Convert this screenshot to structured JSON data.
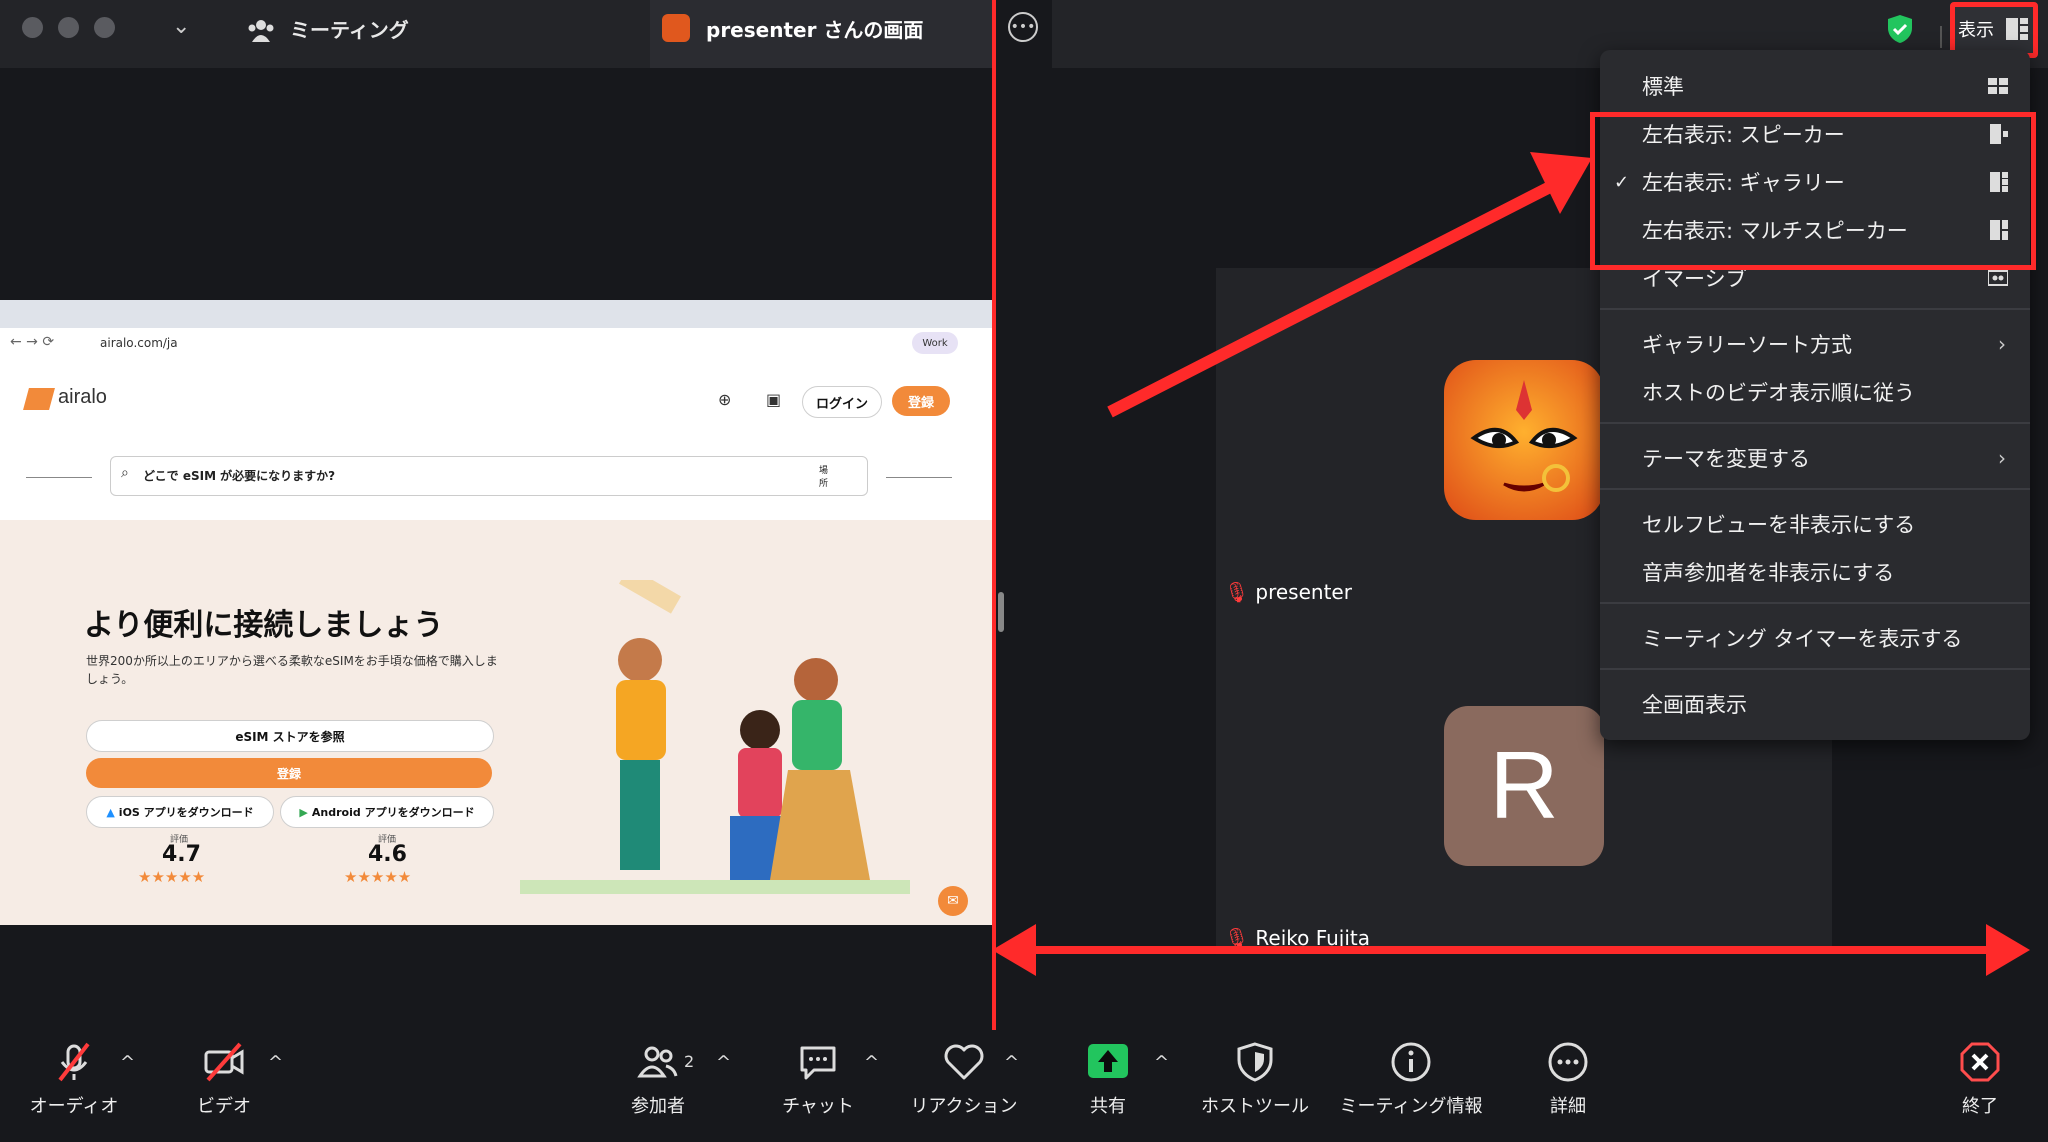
{
  "window": {
    "meeting_title": "ミーティング",
    "presenter_tab": "presenter さんの画面"
  },
  "header_right": {
    "view_label": "表示"
  },
  "view_menu": {
    "items": [
      {
        "label": "標準",
        "checked": false,
        "icon": "grid-icon"
      },
      {
        "label": "左右表示: スピーカー",
        "checked": false,
        "icon": "side-speaker-icon"
      },
      {
        "label": "左右表示: ギャラリー",
        "checked": true,
        "icon": "side-gallery-icon"
      },
      {
        "label": "左右表示: マルチスピーカー",
        "checked": false,
        "icon": "side-multi-icon"
      },
      {
        "label": "イマーシブ",
        "checked": false,
        "icon": "immersive-icon"
      },
      {
        "label": "ギャラリーソート方式",
        "submenu": true
      },
      {
        "label": "ホストのビデオ表示順に従う"
      },
      {
        "label": "テーマを変更する",
        "submenu": true
      },
      {
        "label": "セルフビューを非表示にする"
      },
      {
        "label": "音声参加者を非表示にする"
      },
      {
        "label": "ミーティング タイマーを表示する"
      },
      {
        "label": "全画面表示"
      }
    ],
    "checkmark": "✓",
    "chevron": "›"
  },
  "participants_view": {
    "presenter_name": "presenter",
    "reiko_name": "Reiko Fujita",
    "reiko_initial": "R"
  },
  "shared_screen": {
    "address": "airalo.com/ja",
    "work_badge": "Work",
    "logo": "airalo",
    "login": "ログイン",
    "register": "登録",
    "search_placeholder": "どこで eSIM が必要になりますか?",
    "search_scope": "場所",
    "hero_title": "より便利に接続しましょう",
    "hero_desc": "世界200か所以上のエリアから選べる柔軟なeSIMをお手頃な価格で購入しましょう。",
    "store_button": "eSIM ストアを参照",
    "signup_button": "登録",
    "ios_button": "iOS アプリをダウンロード",
    "android_button": "Android アプリをダウンロード",
    "rating_label": "評価",
    "ios_rating": "4.7",
    "android_rating": "4.6",
    "stars": "★★★★★"
  },
  "toolbar": {
    "audio": "オーディオ",
    "video": "ビデオ",
    "participants": "参加者",
    "participants_count": "2",
    "chat": "チャット",
    "reactions": "リアクション",
    "share": "共有",
    "host_tools": "ホストツール",
    "meeting_info": "ミーティング情報",
    "more": "詳細",
    "end": "終了",
    "caret": "^"
  },
  "colors": {
    "annotation_red": "#ff2a2a",
    "share_green": "#22c55e",
    "airalo_orange": "#f28a3a"
  }
}
